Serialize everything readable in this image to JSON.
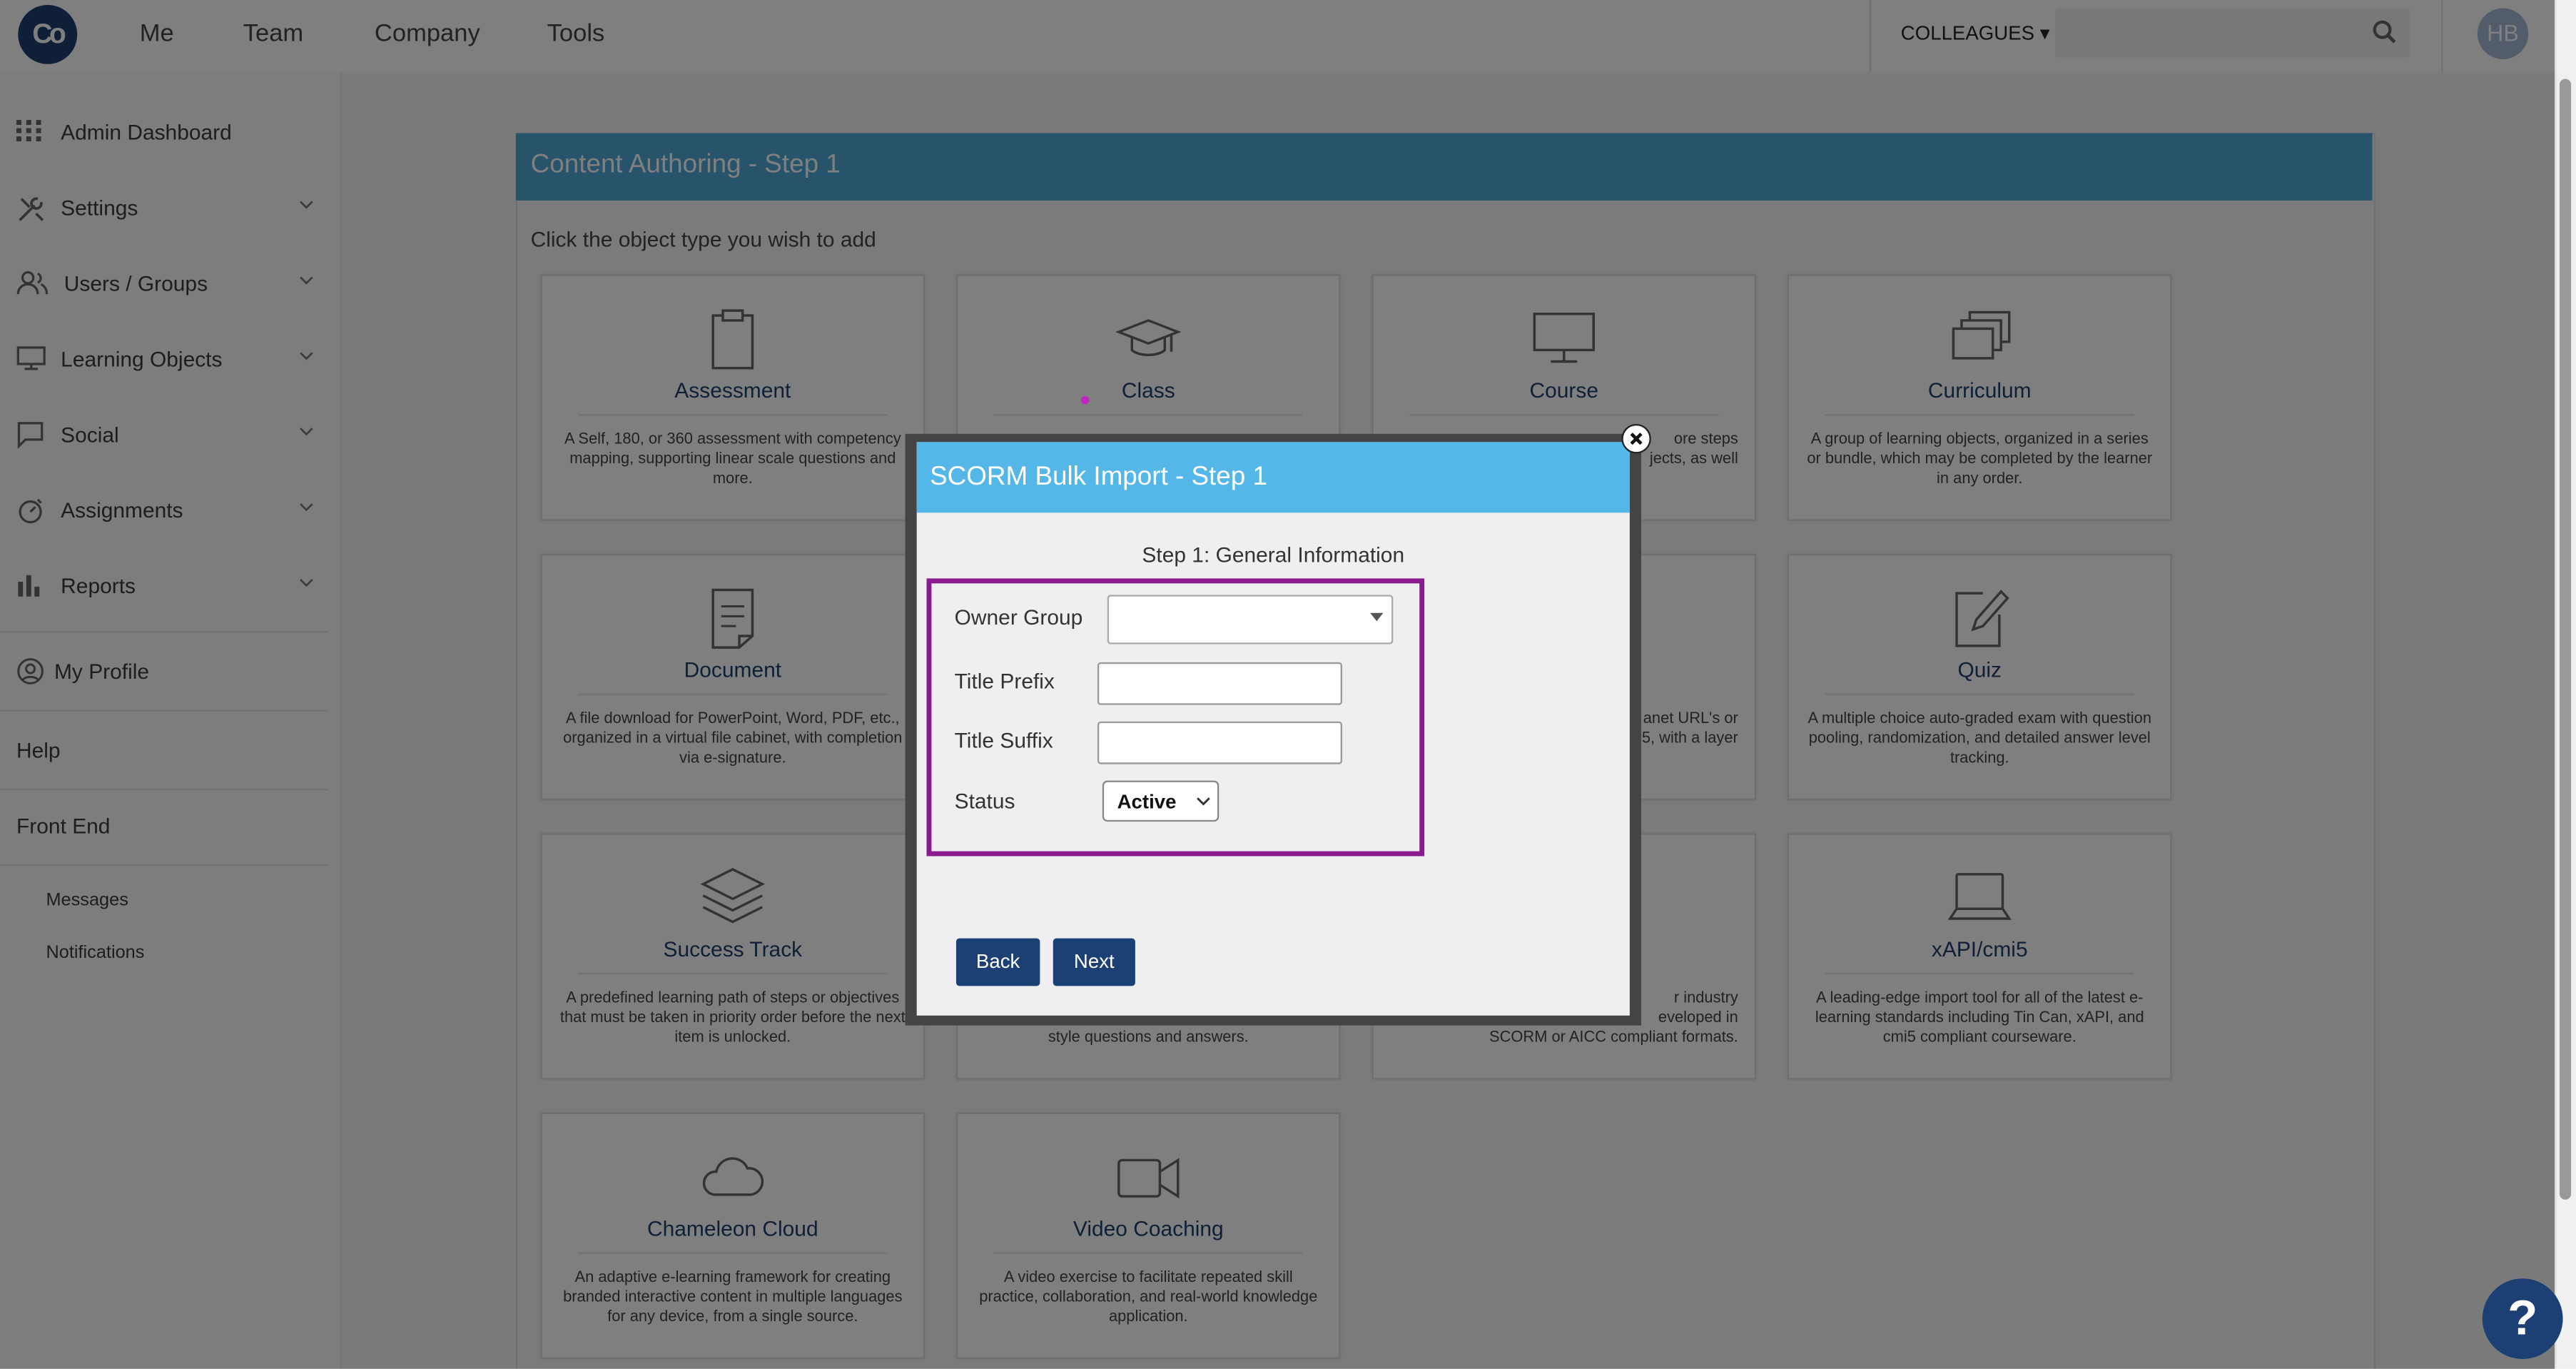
{
  "brand": {
    "logo_text": "Co"
  },
  "topnav": {
    "items": [
      "Me",
      "Team",
      "Company",
      "Tools"
    ],
    "colleagues_label": "COLLEAGUES",
    "search_placeholder": "",
    "avatar_initials": "HB"
  },
  "sidebar": {
    "items": [
      {
        "label": "Admin Dashboard",
        "icon": "grid-icon",
        "expandable": false
      },
      {
        "label": "Settings",
        "icon": "tools-icon",
        "expandable": true
      },
      {
        "label": "Users / Groups",
        "icon": "users-icon",
        "expandable": true
      },
      {
        "label": "Learning Objects",
        "icon": "monitor-icon",
        "expandable": true
      },
      {
        "label": "Social",
        "icon": "chat-icon",
        "expandable": true
      },
      {
        "label": "Assignments",
        "icon": "stopwatch-icon",
        "expandable": true
      },
      {
        "label": "Reports",
        "icon": "bar-chart-icon",
        "expandable": true
      }
    ],
    "my_profile": "My Profile",
    "help": "Help",
    "front_end": "Front End",
    "messages": "Messages",
    "notifications": "Notifications"
  },
  "content": {
    "title": "Content Authoring - Step 1",
    "instruction": "Click the object type you wish to add",
    "cards": [
      {
        "title": "Assessment",
        "desc": "A Self, 180, or 360 assessment with competency mapping, supporting linear scale questions and more.",
        "icon": "clipboard-icon"
      },
      {
        "title": "Class",
        "desc": "",
        "icon": "graduation-cap-icon"
      },
      {
        "title": "Course",
        "desc": "ore steps\njects, as well",
        "icon": "monitor-icon"
      },
      {
        "title": "Curriculum",
        "desc": "A group of learning objects, organized in a series or bundle, which may be completed by the learner in any order.",
        "icon": "stacked-windows-icon"
      },
      {
        "title": "Document",
        "desc": "A file download for PowerPoint, Word, PDF, etc., organized in a virtual file cabinet, with completion via e-signature.",
        "icon": "document-icon"
      },
      {
        "title": "",
        "desc": "",
        "icon": ""
      },
      {
        "title": "",
        "desc": "anet URL's or\n5, with a layer",
        "icon": ""
      },
      {
        "title": "Quiz",
        "desc": "A multiple choice auto-graded exam with question pooling, randomization, and detailed answer level tracking.",
        "icon": "pencil-paper-icon"
      },
      {
        "title": "Success Track",
        "desc": "A predefined learning path of steps or objectives that must be taken in priority order before the next item is unlocked.",
        "icon": "layers-icon"
      },
      {
        "title": "",
        "desc": "style questions and answers.",
        "icon": ""
      },
      {
        "title": "",
        "desc": "r industry\neveloped in\nSCORM or AICC compliant formats.",
        "icon": ""
      },
      {
        "title": "xAPI/cmi5",
        "desc": "A leading-edge import tool for all of the latest e-learning standards including Tin Can, xAPI, and cmi5 compliant courseware.",
        "icon": "laptop-icon"
      },
      {
        "title": "Chameleon Cloud",
        "desc": "An adaptive e-learning framework for creating branded interactive content in multiple languages for any device, from a single source.",
        "icon": "cloud-icon"
      },
      {
        "title": "Video Coaching",
        "desc": "A video exercise to facilitate repeated skill practice, collaboration, and real-world knowledge application.",
        "icon": "video-camera-icon"
      }
    ]
  },
  "modal": {
    "title": "SCORM Bulk Import - Step 1",
    "step_title": "Step 1: General Information",
    "owner_group_label": "Owner Group",
    "owner_group_value": "",
    "title_prefix_label": "Title Prefix",
    "title_prefix_value": "",
    "title_suffix_label": "Title Suffix",
    "title_suffix_value": "",
    "status_label": "Status",
    "status_value": "Active",
    "back_label": "Back",
    "next_label": "Next",
    "highlight_color": "#8b1a8f"
  },
  "help_bubble": {
    "label": "?"
  },
  "colors": {
    "header_blue": "#4ea7d6",
    "modal_header": "#55b7e8",
    "navy": "#1c3f74"
  }
}
